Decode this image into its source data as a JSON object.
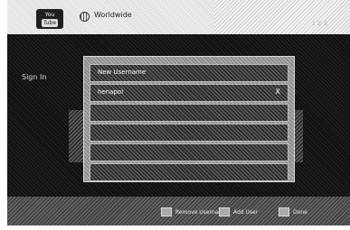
{
  "header": {
    "logo_top": "You",
    "logo_bottom": "Tube",
    "region": "Worldwide",
    "badge": "1 2 3"
  },
  "section_title": "Sign In",
  "dialog": {
    "rows": [
      {
        "label": "New Username"
      },
      {
        "label": "henapol",
        "clear": "X"
      },
      {
        "label": ""
      },
      {
        "label": ""
      },
      {
        "label": ""
      },
      {
        "label": ""
      }
    ]
  },
  "footer": {
    "items": [
      {
        "label": "Remove Username"
      },
      {
        "label": "Add User"
      },
      {
        "label": "Done"
      }
    ]
  }
}
